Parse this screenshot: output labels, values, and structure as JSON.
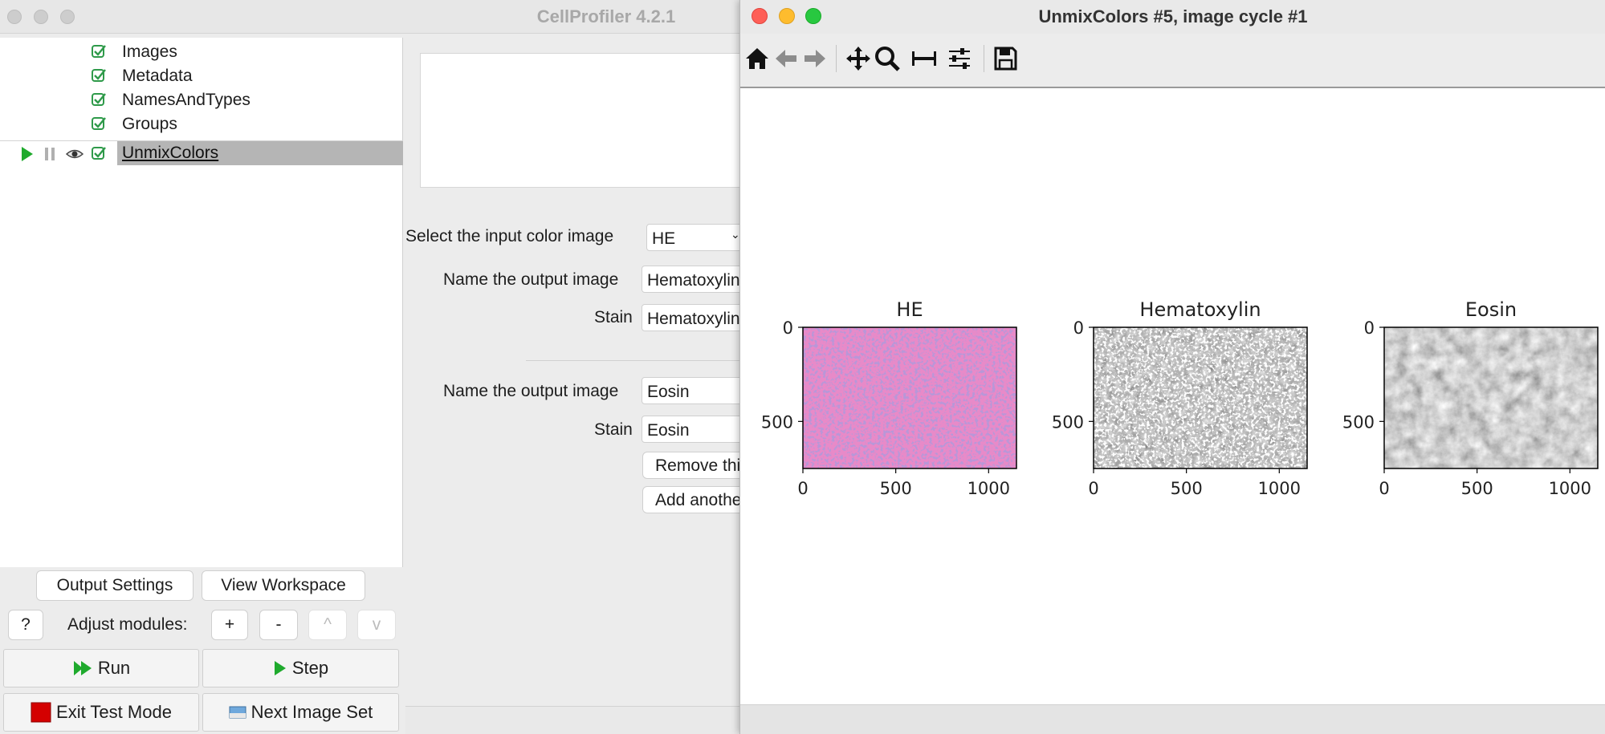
{
  "main_window": {
    "title": "CellProfiler 4.2.1"
  },
  "pipeline": {
    "modules": [
      {
        "name": "Images",
        "enabled": true
      },
      {
        "name": "Metadata",
        "enabled": true
      },
      {
        "name": "NamesAndTypes",
        "enabled": true
      },
      {
        "name": "Groups",
        "enabled": true
      },
      {
        "name": "UnmixColors",
        "enabled": true,
        "selected": true
      }
    ],
    "icons": {
      "run": "play-icon",
      "pause": "pause-icon",
      "eye": "eye-icon",
      "check": "checkbox-checked-icon"
    }
  },
  "settings": {
    "input_label": "Select the input color image",
    "input_value": "HE",
    "output1_label": "Name the output image",
    "output1_value": "Hematoxylin",
    "stain1_label": "Stain",
    "stain1_value": "Hematoxylin",
    "output2_label": "Name the output image",
    "output2_value": "Eosin",
    "stain2_label": "Stain",
    "stain2_value": "Eosin",
    "remove_button": "Remove this image",
    "add_button": "Add another image"
  },
  "controls": {
    "output_settings": "Output Settings",
    "view_workspace": "View Workspace",
    "help": "?",
    "adjust_label": "Adjust modules:",
    "add": "+",
    "remove": "-",
    "up": "^",
    "down": "v",
    "run": "Run",
    "step": "Step",
    "exit_test": "Exit Test Mode",
    "next_image_set": "Next Image Set"
  },
  "figure_window": {
    "title": "UnmixColors #5, image cycle #1",
    "toolbar": [
      "home-icon",
      "back-arrow-icon",
      "forward-arrow-icon",
      "pan-icon",
      "zoom-icon",
      "measure-icon",
      "subplots-config-icon",
      "save-icon"
    ]
  },
  "chart_data": [
    {
      "type": "heatmap",
      "title": "HE",
      "colormap": "rgb",
      "x_ticks": [
        0,
        500,
        1000
      ],
      "y_ticks": [
        0,
        500
      ],
      "xlim": [
        0,
        1150
      ],
      "ylim": [
        750,
        0
      ]
    },
    {
      "type": "heatmap",
      "title": "Hematoxylin",
      "colormap": "gray",
      "x_ticks": [
        0,
        500,
        1000
      ],
      "y_ticks": [
        0,
        500
      ],
      "xlim": [
        0,
        1150
      ],
      "ylim": [
        750,
        0
      ]
    },
    {
      "type": "heatmap",
      "title": "Eosin",
      "colormap": "gray",
      "x_ticks": [
        0,
        500,
        1000
      ],
      "y_ticks": [
        0,
        500
      ],
      "xlim": [
        0,
        1150
      ],
      "ylim": [
        750,
        0
      ]
    }
  ],
  "colors": {
    "he_pink": "#e88ac8",
    "he_purple": "#7a4fb0",
    "selection_gray": "#b5b5b5",
    "run_green": "#1faa2d",
    "exit_red": "#d40000",
    "close_red": "#fe5f57",
    "minimize_yellow": "#febc2e",
    "zoom_green": "#28c840"
  }
}
